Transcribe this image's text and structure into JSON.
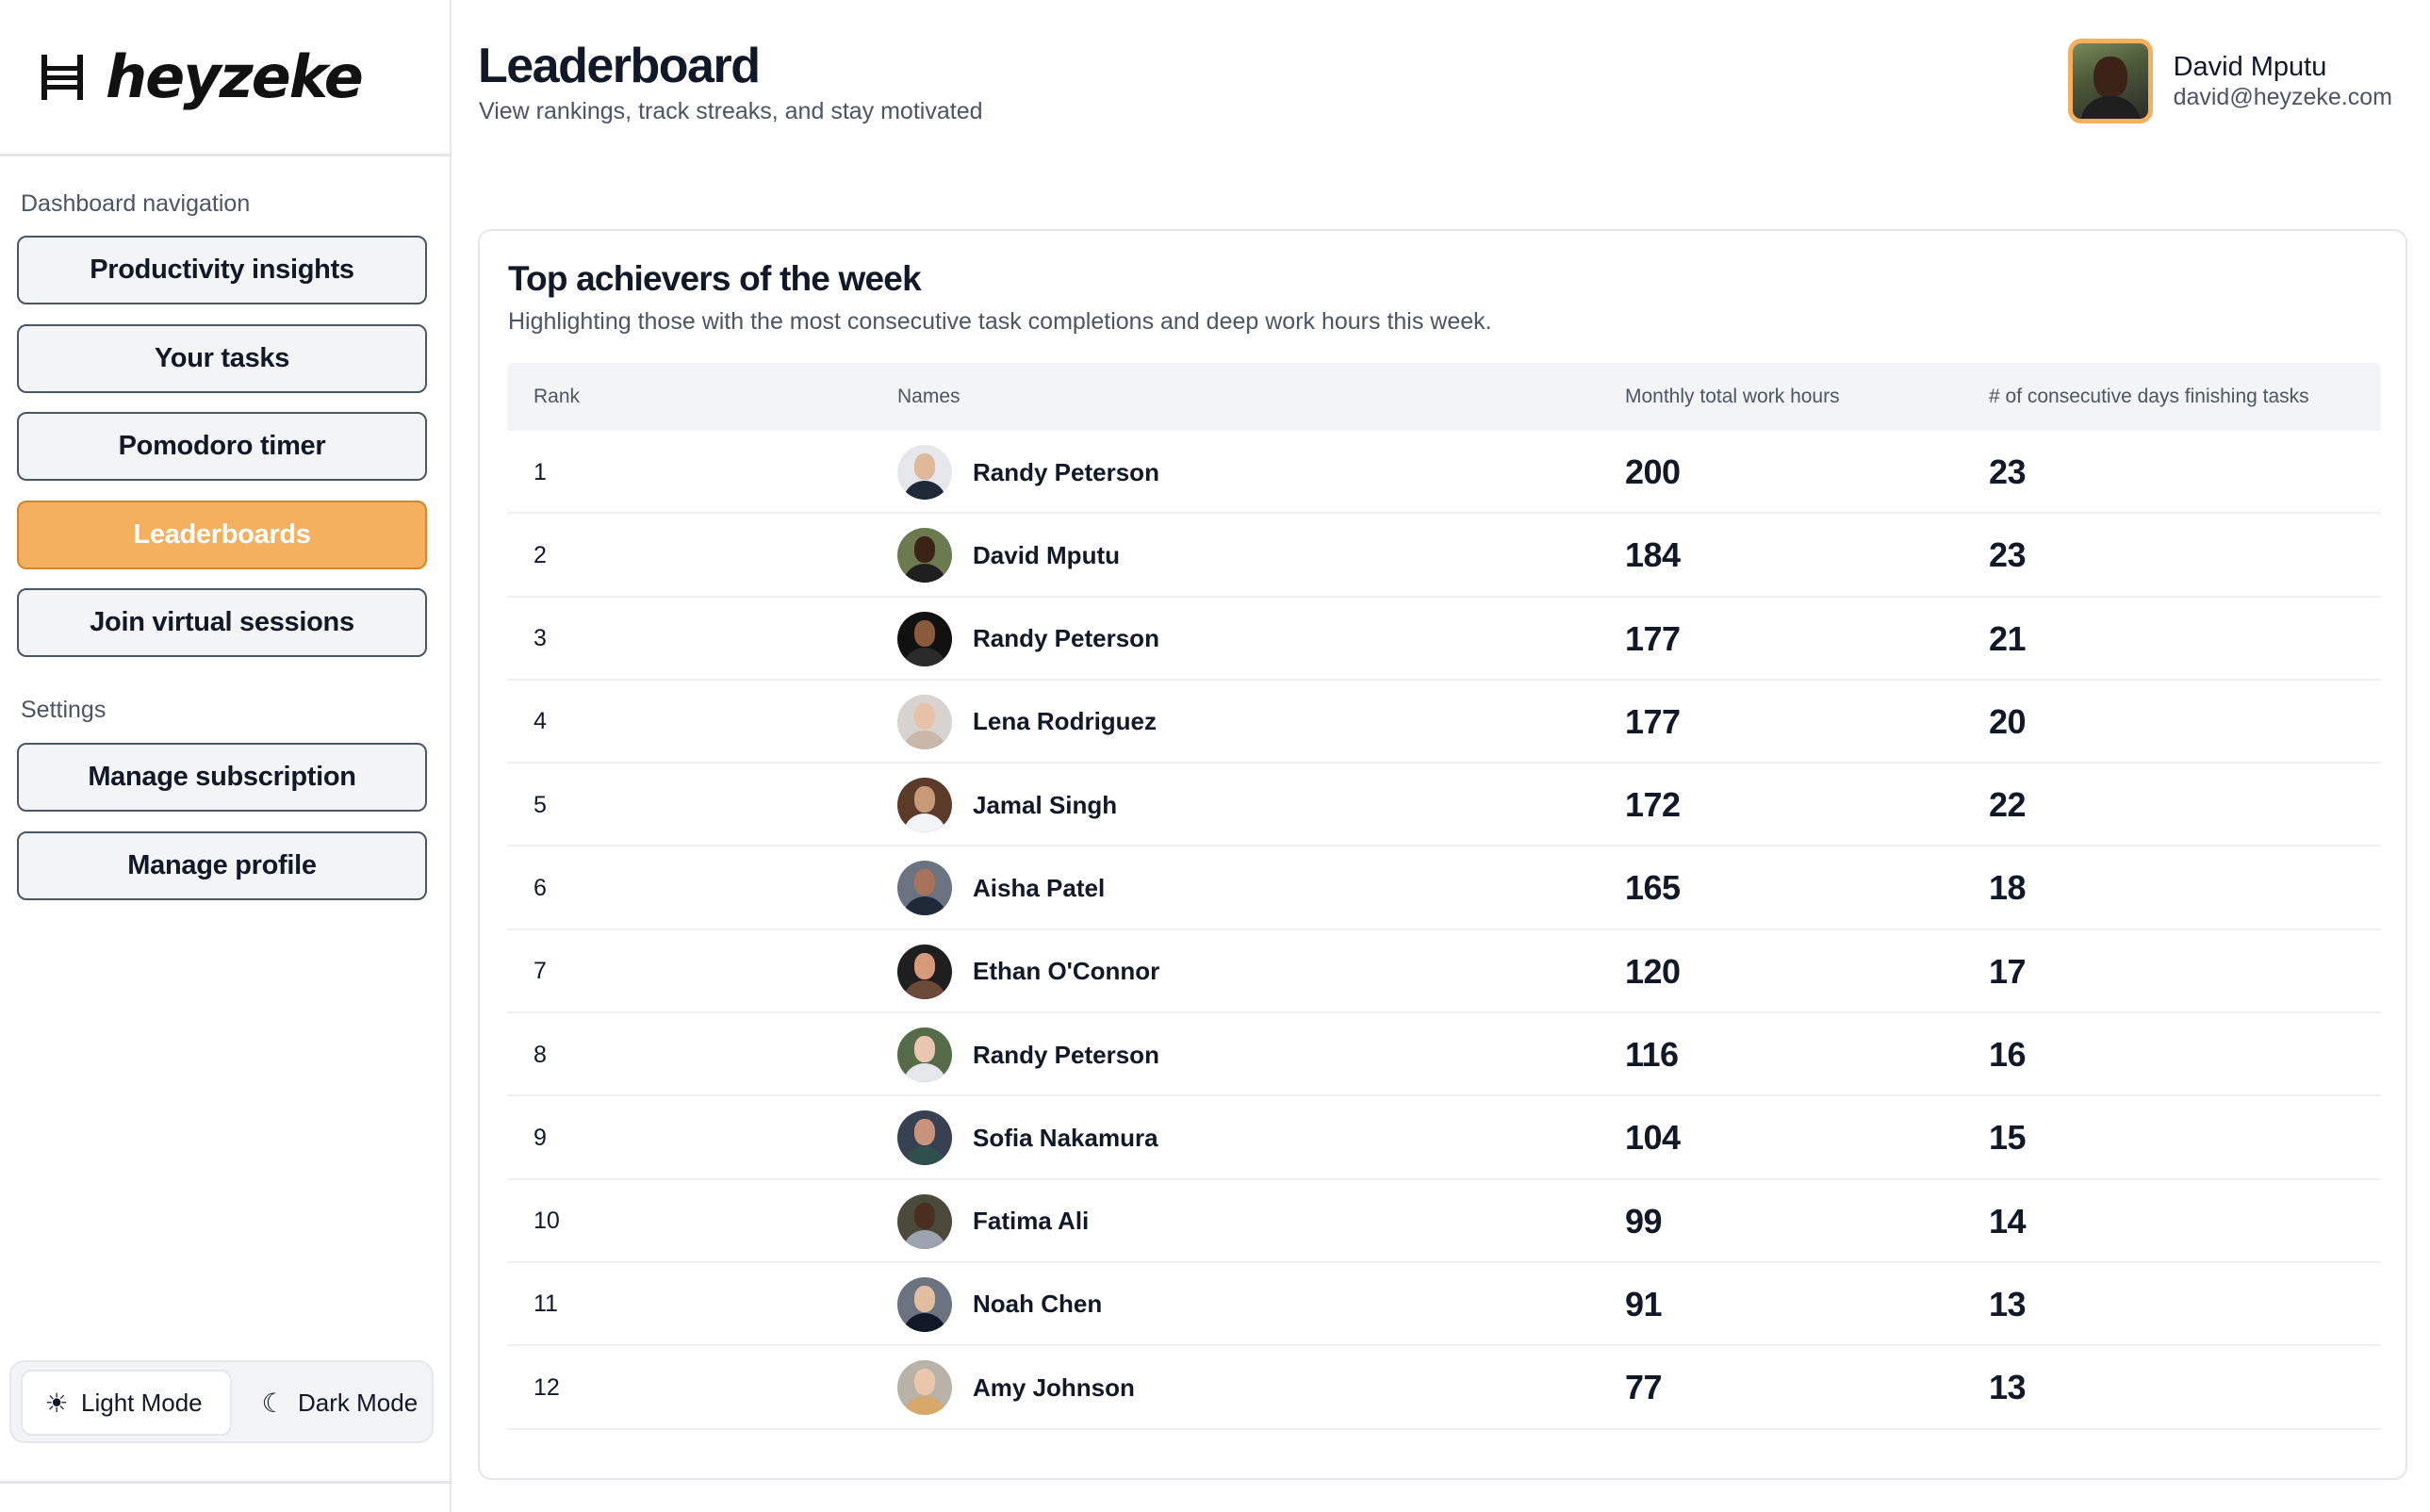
{
  "app": {
    "brand": "heyzeke"
  },
  "header": {
    "title": "Leaderboard",
    "subtitle": "View rankings, track streaks, and stay motivated"
  },
  "user": {
    "name": "David Mputu",
    "email": "david@heyzeke.com"
  },
  "sidebar": {
    "nav_label": "Dashboard navigation",
    "nav_items": [
      {
        "label": "Productivity insights",
        "active": false
      },
      {
        "label": "Your tasks",
        "active": false
      },
      {
        "label": "Pomodoro timer",
        "active": false
      },
      {
        "label": "Leaderboards",
        "active": true
      },
      {
        "label": "Join virtual sessions",
        "active": false
      }
    ],
    "settings_label": "Settings",
    "settings_items": [
      {
        "label": "Manage subscription"
      },
      {
        "label": "Manage profile"
      }
    ],
    "mode_toggle": {
      "light_label": "Light Mode",
      "dark_label": "Dark Mode",
      "selected": "light"
    }
  },
  "leaderboard": {
    "title": "Top achievers of the week",
    "description": "Highlighting those with the most consecutive task completions and deep work hours this week.",
    "columns": [
      "Rank",
      "Names",
      "Monthly total work hours",
      "# of consecutive days finishing tasks"
    ],
    "rows": [
      {
        "rank": "1",
        "name": "Randy Peterson",
        "hours": "200",
        "days": "23",
        "avatar_bg": "#e5e7eb",
        "skin": "#e0b89a",
        "shirt": "#1f2937"
      },
      {
        "rank": "2",
        "name": "David Mputu",
        "hours": "184",
        "days": "23",
        "avatar_bg": "#6b7a4f",
        "skin": "#3b2417",
        "shirt": "#1f1f1f"
      },
      {
        "rank": "3",
        "name": "Randy Peterson",
        "hours": "177",
        "days": "21",
        "avatar_bg": "#111111",
        "skin": "#8a5a3c",
        "shirt": "#2b2b2b"
      },
      {
        "rank": "4",
        "name": "Lena Rodriguez",
        "hours": "177",
        "days": "20",
        "avatar_bg": "#d6d3d1",
        "skin": "#e8c2a6",
        "shirt": "#c9b8a8"
      },
      {
        "rank": "5",
        "name": "Jamal Singh",
        "hours": "172",
        "days": "22",
        "avatar_bg": "#5b3a2a",
        "skin": "#c79a78",
        "shirt": "#f3f4f6"
      },
      {
        "rank": "6",
        "name": "Aisha Patel",
        "hours": "165",
        "days": "18",
        "avatar_bg": "#6b7280",
        "skin": "#a8735a",
        "shirt": "#1f2937"
      },
      {
        "rank": "7",
        "name": "Ethan O'Connor",
        "hours": "120",
        "days": "17",
        "avatar_bg": "#1f1f1f",
        "skin": "#d69a7a",
        "shirt": "#6b4a3a"
      },
      {
        "rank": "8",
        "name": "Randy Peterson",
        "hours": "116",
        "days": "16",
        "avatar_bg": "#556b4a",
        "skin": "#e8c6b0",
        "shirt": "#e5e7eb"
      },
      {
        "rank": "9",
        "name": "Sofia Nakamura",
        "hours": "104",
        "days": "15",
        "avatar_bg": "#374151",
        "skin": "#c9927a",
        "shirt": "#2f4f4f"
      },
      {
        "rank": "10",
        "name": "Fatima Ali",
        "hours": "99",
        "days": "14",
        "avatar_bg": "#4b4a3a",
        "skin": "#4a2e1f",
        "shirt": "#9ca3af"
      },
      {
        "rank": "11",
        "name": "Noah Chen",
        "hours": "91",
        "days": "13",
        "avatar_bg": "#6b7280",
        "skin": "#e2bea0",
        "shirt": "#111827"
      },
      {
        "rank": "12",
        "name": "Amy Johnson",
        "hours": "77",
        "days": "13",
        "avatar_bg": "#b8b2a8",
        "skin": "#eac6aa",
        "shirt": "#d6a86a"
      }
    ]
  },
  "colors": {
    "accent": "#f4b05e",
    "border": "#e5e7eb",
    "muted_text": "#4b5563"
  }
}
